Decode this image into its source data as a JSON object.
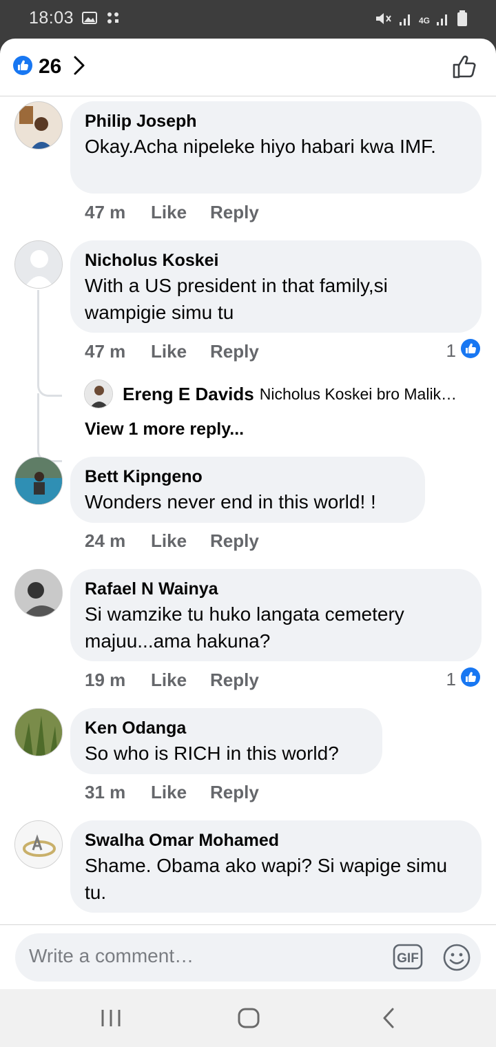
{
  "status_bar": {
    "time": "18:03",
    "network_label": "4G"
  },
  "header": {
    "like_count": "26"
  },
  "comments": [
    {
      "author": "Philip Joseph",
      "text": "Okay.Acha nipeleke hiyo habari kwa IMF.",
      "time": "47 m",
      "like_label": "Like",
      "reply_label": "Reply"
    },
    {
      "author": "Nicholus Koskei",
      "text": "With a US president in that family,si wampigie simu tu",
      "time": "47 m",
      "like_label": "Like",
      "reply_label": "Reply",
      "reactions": "1"
    },
    {
      "author": "Bett Kipngeno",
      "text": "Wonders never end in this world! !",
      "time": "24 m",
      "like_label": "Like",
      "reply_label": "Reply"
    },
    {
      "author": "Rafael N Wainya",
      "text": "Si wamzike tu huko langata cemetery majuu...ama hakuna?",
      "time": "19 m",
      "like_label": "Like",
      "reply_label": "Reply",
      "reactions": "1"
    },
    {
      "author": "Ken Odanga",
      "text": "So who is RICH in this world?",
      "time": "31 m",
      "like_label": "Like",
      "reply_label": "Reply"
    },
    {
      "author": "Swalha Omar Mohamed",
      "text": "Shame. Obama ako wapi? Si wapige simu tu.",
      "time": "",
      "like_label": "",
      "reply_label": ""
    }
  ],
  "reply_preview": {
    "author": "Ereng E Davids",
    "text": "Nicholus Koskei bro Malik…"
  },
  "view_more": "View 1 more reply...",
  "composer": {
    "placeholder": "Write a comment…",
    "gif_label": "GIF"
  },
  "colors": {
    "facebook_blue": "#1877f2",
    "bubble": "#f0f2f5",
    "meta_text": "#65676b"
  },
  "icons": [
    "gallery-icon",
    "vpn-key-icon",
    "mute-icon",
    "signal-icon",
    "battery-icon",
    "like-reaction-icon",
    "chevron-right-icon",
    "thumbs-up-icon",
    "gif-icon",
    "emoji-icon",
    "recents-icon",
    "home-icon",
    "back-icon"
  ]
}
